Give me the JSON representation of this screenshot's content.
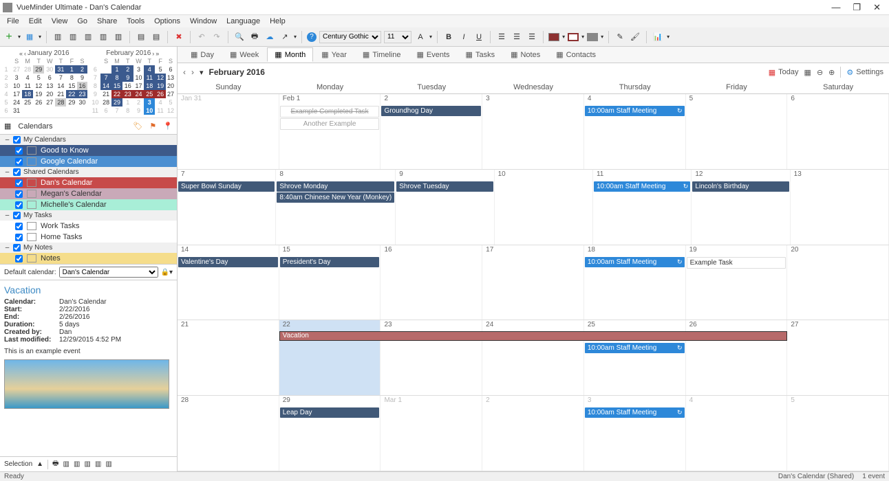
{
  "window": {
    "title": "VueMinder Ultimate - Dan's Calendar"
  },
  "menu": [
    "File",
    "Edit",
    "View",
    "Go",
    "Share",
    "Tools",
    "Options",
    "Window",
    "Language",
    "Help"
  ],
  "toolbar": {
    "font": "Century Gothic",
    "size": "11"
  },
  "miniCals": {
    "left": {
      "title": "January 2016"
    },
    "right": {
      "title": "February 2016"
    }
  },
  "calPanel": {
    "tab": "Calendars",
    "groups": [
      {
        "name": "My Calendars",
        "items": [
          {
            "name": "Good to Know",
            "cls": "blue1"
          },
          {
            "name": "Google Calendar",
            "cls": "blue2"
          }
        ]
      },
      {
        "name": "Shared Calendars",
        "items": [
          {
            "name": "Dan's Calendar",
            "cls": "red"
          },
          {
            "name": "Megan's Calendar",
            "cls": "pink"
          },
          {
            "name": "Michelle's Calendar",
            "cls": "teal"
          }
        ]
      },
      {
        "name": "My Tasks",
        "items": [
          {
            "name": "Work Tasks",
            "cls": ""
          },
          {
            "name": "Home Tasks",
            "cls": ""
          }
        ]
      },
      {
        "name": "My Notes",
        "items": [
          {
            "name": "Notes",
            "cls": "yellow"
          }
        ]
      }
    ],
    "defaultLabel": "Default calendar:",
    "defaultValue": "Dan's Calendar"
  },
  "detail": {
    "title": "Vacation",
    "rows": [
      {
        "lbl": "Calendar:",
        "val": "Dan's Calendar"
      },
      {
        "lbl": "Start:",
        "val": "2/22/2016"
      },
      {
        "lbl": "End:",
        "val": "2/26/2016"
      },
      {
        "lbl": "Duration:",
        "val": "5 days"
      },
      {
        "lbl": "Created by:",
        "val": "Dan"
      },
      {
        "lbl": "Last modified:",
        "val": "12/29/2015 4:52 PM"
      }
    ],
    "note": "This is an example event"
  },
  "selBar": {
    "label": "Selection",
    "arrow": "▲"
  },
  "viewTabs": [
    "Day",
    "Week",
    "Month",
    "Year",
    "Timeline",
    "Events",
    "Tasks",
    "Notes",
    "Contacts"
  ],
  "activeView": "Month",
  "calHead": {
    "month": "February 2016",
    "today": "Today",
    "settings": "Settings"
  },
  "dow": [
    "Sunday",
    "Monday",
    "Tuesday",
    "Wednesday",
    "Thursday",
    "Friday",
    "Saturday"
  ],
  "weeks": [
    {
      "days": [
        {
          "num": "Jan 31",
          "light": true
        },
        {
          "num": "Feb 1",
          "evts": [
            {
              "text": "Example Completed Task",
              "cls": "white strike"
            },
            {
              "text": "Another Example",
              "cls": "white"
            }
          ]
        },
        {
          "num": "2",
          "evts": [
            {
              "text": "Groundhog Day",
              "cls": "blueD"
            }
          ]
        },
        {
          "num": "3"
        },
        {
          "num": "4",
          "evts": [
            {
              "text": "10:00am Staff Meeting",
              "cls": "blueL",
              "r": true
            }
          ]
        },
        {
          "num": "5"
        },
        {
          "num": "6"
        }
      ]
    },
    {
      "days": [
        {
          "num": "7",
          "evts": [
            {
              "text": "Super Bowl Sunday",
              "cls": "blueD"
            }
          ]
        },
        {
          "num": "8",
          "evts": [
            {
              "text": "Shrove Monday",
              "cls": "blueD"
            },
            {
              "text": "8:40am Chinese New Year (Monkey)",
              "cls": "blueD"
            }
          ]
        },
        {
          "num": "9",
          "evts": [
            {
              "text": "Shrove Tuesday",
              "cls": "blueD"
            }
          ]
        },
        {
          "num": "10"
        },
        {
          "num": "11",
          "evts": [
            {
              "text": "10:00am Staff Meeting",
              "cls": "blueL",
              "r": true
            }
          ]
        },
        {
          "num": "12",
          "evts": [
            {
              "text": "Lincoln's Birthday",
              "cls": "blueD"
            }
          ]
        },
        {
          "num": "13"
        }
      ]
    },
    {
      "days": [
        {
          "num": "14",
          "evts": [
            {
              "text": "Valentine's Day",
              "cls": "blueD"
            }
          ]
        },
        {
          "num": "15",
          "evts": [
            {
              "text": "President's Day",
              "cls": "blueD"
            }
          ]
        },
        {
          "num": "16"
        },
        {
          "num": "17"
        },
        {
          "num": "18",
          "evts": [
            {
              "text": "10:00am Staff Meeting",
              "cls": "blueL",
              "r": true
            }
          ]
        },
        {
          "num": "19",
          "evts": [
            {
              "text": "Example Task",
              "cls": "plain"
            }
          ]
        },
        {
          "num": "20"
        }
      ]
    },
    {
      "vacation": "Vacation",
      "days": [
        {
          "num": "21"
        },
        {
          "num": "22",
          "sel": true
        },
        {
          "num": "23"
        },
        {
          "num": "24"
        },
        {
          "num": "25",
          "evts": [
            {
              "text": "10:00am Staff Meeting",
              "cls": "blueL",
              "r": true,
              "push": true
            }
          ]
        },
        {
          "num": "26"
        },
        {
          "num": "27"
        }
      ]
    },
    {
      "days": [
        {
          "num": "28"
        },
        {
          "num": "29",
          "evts": [
            {
              "text": "Leap Day",
              "cls": "blueD"
            }
          ]
        },
        {
          "num": "Mar 1",
          "light": true
        },
        {
          "num": "2",
          "light": true
        },
        {
          "num": "3",
          "light": true,
          "evts": [
            {
              "text": "10:00am Staff Meeting",
              "cls": "blueL",
              "r": true
            }
          ]
        },
        {
          "num": "4",
          "light": true
        },
        {
          "num": "5",
          "light": true
        }
      ]
    }
  ],
  "status": {
    "left": "Ready",
    "right1": "Dan's Calendar (Shared)",
    "right2": "1 event"
  }
}
